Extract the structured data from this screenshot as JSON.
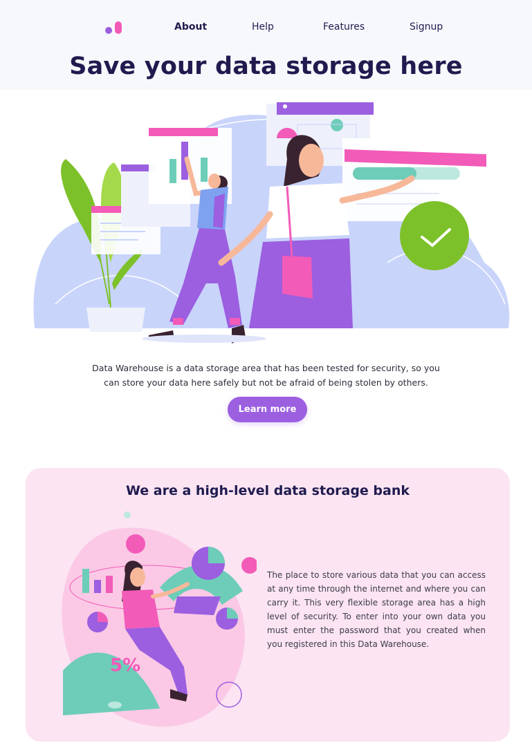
{
  "nav": {
    "logo_icon": "brand-logo-icon",
    "items": [
      "About",
      "Help",
      "Features",
      "Signup"
    ]
  },
  "hero": {
    "title": "Save your data storage here",
    "description": "Data Warehouse is a data storage area that has been tested for security, so you can store your data here safely but not be afraid of being stolen by others.",
    "cta_label": "Learn more"
  },
  "bank": {
    "title": "We are a high-level data storage bank",
    "description": "The place to store various data that you can access at any time through the internet and where you can carry it. This very flexible storage area has a high level of security. To enter into your own data you must enter the password that you created when you registered in this Data Warehouse.",
    "illustration_badge": "5%"
  },
  "colors": {
    "primary": "#9b5fe0",
    "pink": "#f25bb8",
    "navy": "#1f1b4f",
    "green": "#7dc12a",
    "teal": "#6dcdb8",
    "card_bg": "#fce4f3"
  }
}
